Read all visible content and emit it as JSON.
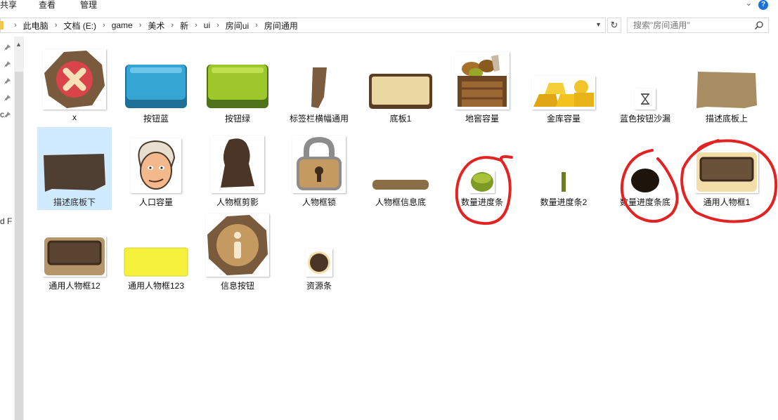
{
  "ribbon": {
    "tabs": [
      "共享",
      "查看",
      "管理"
    ]
  },
  "address": {
    "crumbs": [
      "此电脑",
      "文档 (E:)",
      "game",
      "美术",
      "新",
      "ui",
      "房间ui",
      "房间通用"
    ]
  },
  "search": {
    "placeholder": "搜索\"房间通用\""
  },
  "nav_cutoff": {
    "line1": "c",
    "line2": "d F"
  },
  "files": [
    {
      "name": "x",
      "icon": "close-x-badge-icon"
    },
    {
      "name": "按钮蓝",
      "icon": "blue-button-icon"
    },
    {
      "name": "按钮绿",
      "icon": "green-button-icon"
    },
    {
      "name": "标签栏横幅通用",
      "icon": "tag-banner-icon"
    },
    {
      "name": "底板1",
      "icon": "panel-board-icon"
    },
    {
      "name": "地窖容量",
      "icon": "cellar-crate-icon"
    },
    {
      "name": "金库容量",
      "icon": "gold-bars-icon"
    },
    {
      "name": "蓝色按钮沙漏",
      "icon": "hourglass-icon"
    },
    {
      "name": "描述底板上",
      "icon": "description-panel-top-icon"
    },
    {
      "name": "描述底板下",
      "icon": "description-panel-bottom-icon"
    },
    {
      "name": "人口容量",
      "icon": "villager-face-icon"
    },
    {
      "name": "人物框剪影",
      "icon": "silhouette-icon"
    },
    {
      "name": "人物框锁",
      "icon": "padlock-icon"
    },
    {
      "name": "人物框信息底",
      "icon": "info-strip-icon"
    },
    {
      "name": "数量进度条",
      "icon": "green-pill-icon"
    },
    {
      "name": "数量进度条2",
      "icon": "green-bar-icon"
    },
    {
      "name": "数量进度条底",
      "icon": "dark-pill-icon"
    },
    {
      "name": "通用人物框1",
      "icon": "character-frame-icon"
    },
    {
      "name": "通用人物框12",
      "icon": "character-frame-icon"
    },
    {
      "name": "通用人物框123",
      "icon": "yellow-frame-icon"
    },
    {
      "name": "信息按钮",
      "icon": "info-badge-icon"
    },
    {
      "name": "资源条",
      "icon": "resource-circle-icon"
    }
  ]
}
